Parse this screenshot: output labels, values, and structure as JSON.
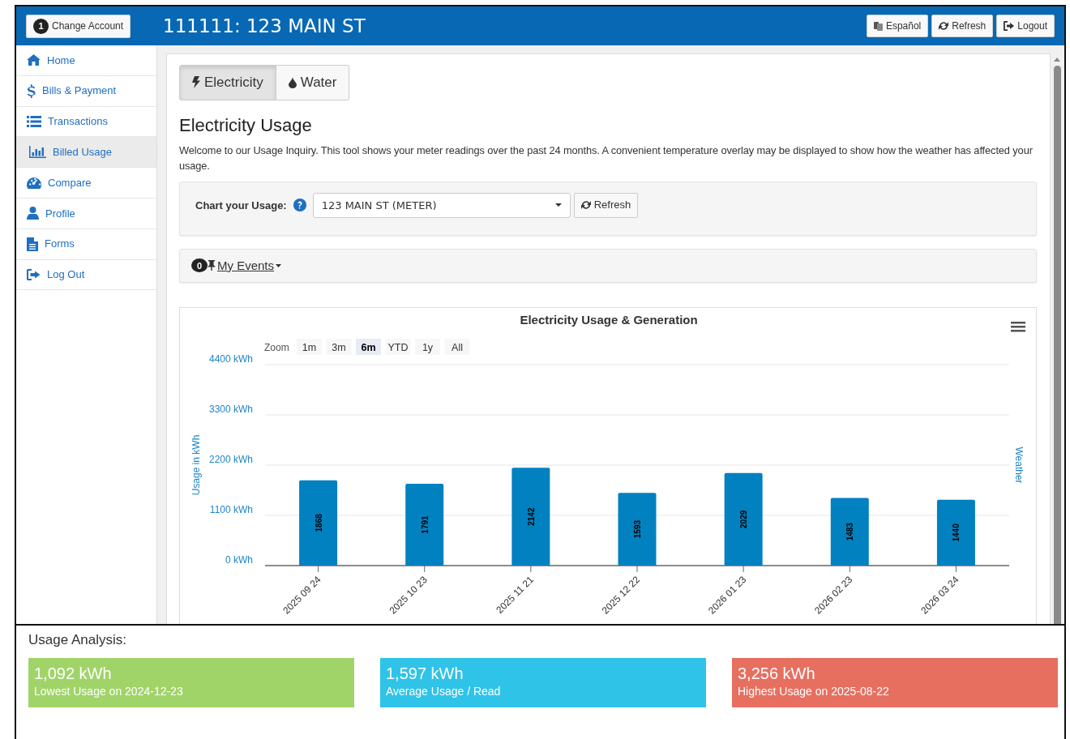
{
  "header": {
    "account_button": {
      "badge": "1",
      "label": "Change Account"
    },
    "title": "111111: 123 MAIN ST",
    "buttons": [
      {
        "label": "Español"
      },
      {
        "label": "Refresh"
      },
      {
        "label": "Logout"
      }
    ]
  },
  "sidebar": {
    "items": [
      {
        "label": "Home",
        "selected": false
      },
      {
        "label": "Bills & Payment",
        "selected": false
      },
      {
        "label": "Transactions",
        "selected": false
      },
      {
        "label": "Billed Usage",
        "selected": true
      },
      {
        "label": "Compare",
        "selected": false
      },
      {
        "label": "Profile",
        "selected": false
      },
      {
        "label": "Forms",
        "selected": false
      },
      {
        "label": "Log Out",
        "selected": false
      }
    ]
  },
  "utility_tabs": [
    {
      "label": "Electricity",
      "selected": true
    },
    {
      "label": "Water",
      "selected": false
    }
  ],
  "heading": "Electricity Usage",
  "intro": "Welcome to our Usage Inquiry. This tool shows your meter readings over the past 24 months. A convenient temperature overlay may be displayed to show how the weather has affected your usage.",
  "meter_form": {
    "label": "Chart your Usage:",
    "select_value": "123 MAIN ST (METER)",
    "button": "Refresh"
  },
  "events": {
    "count": "0",
    "label": "My Events"
  },
  "chart": {
    "zoom_label": "Zoom",
    "zoom_buttons": [
      {
        "label": "1m",
        "selected": false
      },
      {
        "label": "3m",
        "selected": false
      },
      {
        "label": "6m",
        "selected": true
      },
      {
        "label": "YTD",
        "selected": false
      },
      {
        "label": "1y",
        "selected": false
      },
      {
        "label": "All",
        "selected": false
      }
    ],
    "right_axis_title": "Weather",
    "chart_data": {
      "type": "bar",
      "title": "Electricity Usage & Generation",
      "ylabel": "Usage in kWh",
      "categories": [
        "2025 09 24",
        "2025 10 23",
        "2025 11 21",
        "2025 12 22",
        "2026 01 23",
        "2026 02 23",
        "2026 03 24"
      ],
      "series": [
        {
          "color": "#0281c0",
          "values": [
            1868,
            1791,
            2142,
            1593,
            2029,
            1483,
            1440
          ]
        }
      ],
      "ylim": [
        0,
        4400
      ],
      "yticks": [
        {
          "value": 0,
          "label": "0 kWh"
        },
        {
          "value": 1100,
          "label": "1100 kWh"
        },
        {
          "value": 2200,
          "label": "2200 kWh"
        },
        {
          "value": 3300,
          "label": "3300 kWh"
        },
        {
          "value": 4400,
          "label": "4400 kWh"
        }
      ],
      "data_labels": true,
      "grid": true
    }
  },
  "usage_analysis": {
    "title": "Usage Analysis:",
    "cards": [
      {
        "value": "1,092 kWh",
        "caption": "Lowest Usage on 2024-12-23",
        "color": "#a0d468"
      },
      {
        "value": "1,597 kWh",
        "caption": "Average Usage / Read",
        "color": "#2fc3e8"
      },
      {
        "value": "3,256 kWh",
        "caption": "Highest Usage on 2025-08-22",
        "color": "#e66f60"
      }
    ]
  }
}
